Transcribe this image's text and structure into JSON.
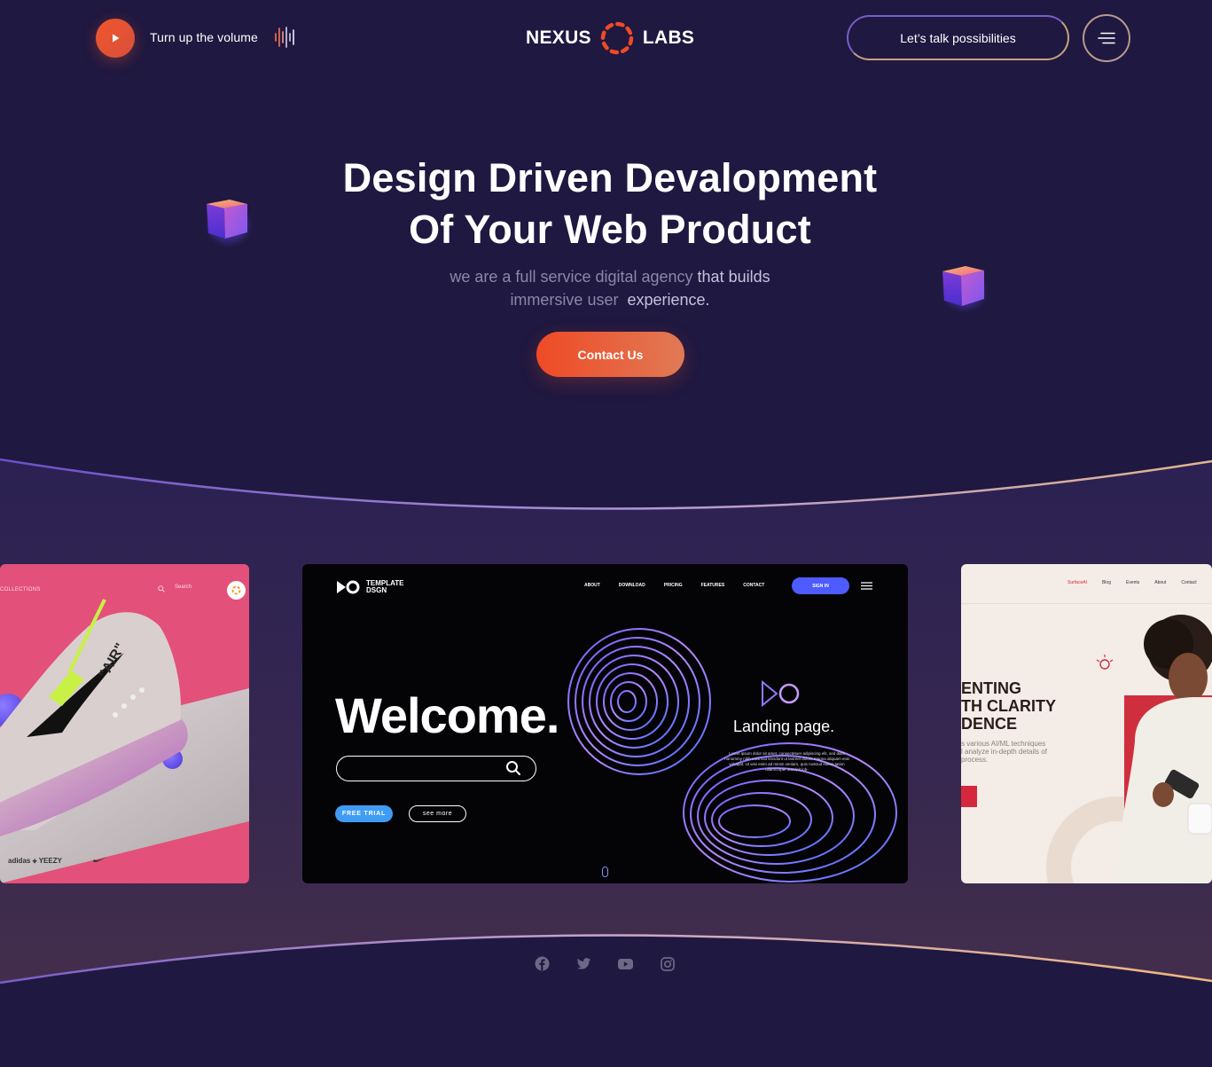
{
  "header": {
    "volume_label": "Turn up the volume",
    "logo_left": "NEXUS",
    "logo_right": "LABS",
    "talk_button": "Let’s talk possibilities"
  },
  "hero": {
    "title_line1": "Design Driven Devalopment",
    "title_line2": "Of Your Web Product",
    "subtitle_a": "we are a full service digital agency",
    "subtitle_b": "that builds",
    "subtitle_c": "immersive user",
    "subtitle_d": "experience.",
    "cta": "Contact Us"
  },
  "showcase": {
    "left_card": {
      "collections": "COLLECTIONS",
      "search": "Search",
      "shoe_text": "\"AIR\"",
      "brand1": "adidas",
      "brand2": "YEEZY",
      "next": "NEXT"
    },
    "center_card": {
      "logo_line1": "TEMPLATE",
      "logo_line2": "DSGN",
      "nav": [
        "ABOUT",
        "DOWNLOAD",
        "PRICING",
        "FEATURES",
        "CONTACT"
      ],
      "sign_in": "SIGN IN",
      "welcome": "Welcome.",
      "free_trial": "FREE TRIAL",
      "see_more": "see more",
      "landing": "Landing page.",
      "lorem": "Lorem ipsum dolor sit amet, consectetuer adipiscing elit, sed diam nonummy nibh euismod tincidunt ut laoreet dolore magna aliquam erat volutpat. Ut wisi enim ad minim veniam, quis nostrud exerci tation ullamcorper suscipit lob-"
    },
    "right_card": {
      "nav": [
        "SurfaceAI",
        "Blog",
        "Events",
        "About",
        "Contact"
      ],
      "headline": "ENTING\nTH CLARITY\nDENCE",
      "sub": "s various AI/ML techniques\nl analyze in-depth details of\nprocess."
    }
  },
  "footer": {
    "social_icons": [
      "facebook-icon",
      "twitter-icon",
      "youtube-icon",
      "instagram-icon"
    ]
  },
  "colors": {
    "background": "#1f1840",
    "accent_orange": "#ef4a26",
    "band_top": "#2a2050",
    "band_bottom": "#3f2b4c"
  }
}
